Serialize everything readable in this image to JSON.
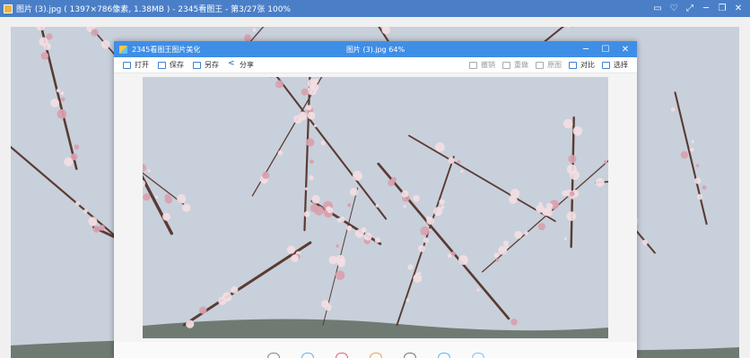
{
  "outer_window": {
    "title": "图片 (3).jpg ( 1397×786像素, 1.38MB ) - 2345看图王 - 第3/27张 100%",
    "buttons": {
      "store": "▭",
      "skin": "♡",
      "fullscreen": "⤢",
      "minimize": "─",
      "restore": "❐",
      "close": "✕"
    }
  },
  "inner_window": {
    "app_title": "2345看图王图片美化",
    "file_title": "图片 (3).jpg  64%",
    "buttons": {
      "minimize": "─",
      "maximize": "☐",
      "close": "✕"
    },
    "toolbar": {
      "open": "打开",
      "save": "保存",
      "save_as": "另存",
      "share": "分享",
      "undo": "撤销",
      "redo": "重做",
      "original": "原图",
      "compare": "对比",
      "select": "选择"
    }
  },
  "colors": {
    "outer_titlebar": "#4a7fc8",
    "inner_titlebar": "#3f8ee6",
    "sky": "#c8d0db",
    "blossom": "#f3dde3"
  }
}
